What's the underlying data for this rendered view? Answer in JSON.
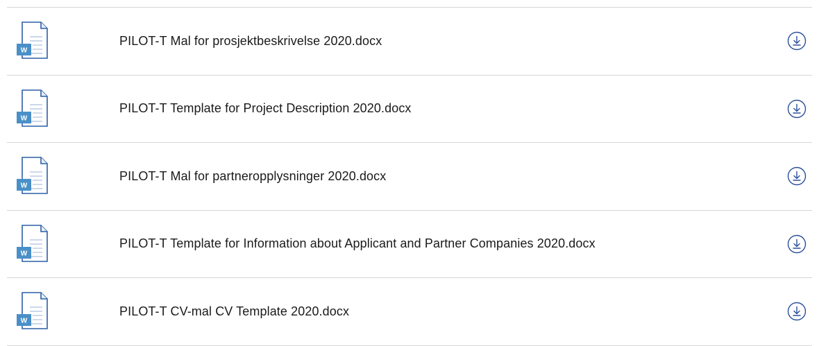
{
  "files": [
    {
      "name": "PILOT-T Mal for prosjektbeskrivelse 2020.docx",
      "icon": "word-document-icon",
      "action": "download-icon"
    },
    {
      "name": "PILOT-T Template for Project Description 2020.docx",
      "icon": "word-document-icon",
      "action": "download-icon"
    },
    {
      "name": "PILOT-T Mal for partneropplysninger 2020.docx",
      "icon": "word-document-icon",
      "action": "download-icon"
    },
    {
      "name": "PILOT-T Template for Information about Applicant and Partner Companies 2020.docx",
      "icon": "word-document-icon",
      "action": "download-icon"
    },
    {
      "name": "PILOT-T CV-mal CV Template 2020.docx",
      "icon": "word-document-icon",
      "action": "download-icon"
    }
  ],
  "icon_label": "W",
  "colors": {
    "word_blue": "#2b5fa6",
    "word_badge": "#4a90c8",
    "download_blue": "#2a4e9a",
    "divider": "#d6d6d6",
    "text": "#1a1a1a"
  }
}
